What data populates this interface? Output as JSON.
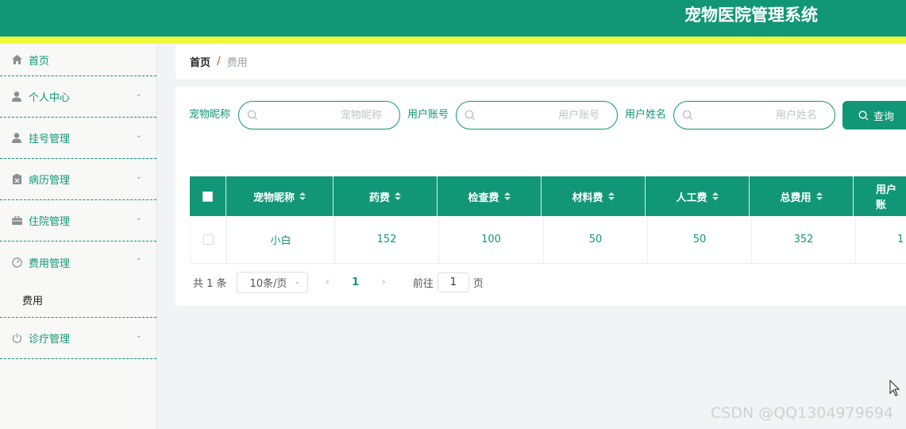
{
  "app": {
    "title": "宠物医院管理系统"
  },
  "colors": {
    "primary": "#119775",
    "accent_bar": "#f0f83c"
  },
  "sidebar": {
    "items": [
      {
        "label": "首页",
        "icon": "home-icon"
      },
      {
        "label": "个人中心",
        "icon": "user-icon"
      },
      {
        "label": "挂号管理",
        "icon": "user-icon"
      },
      {
        "label": "病历管理",
        "icon": "clipboard-icon"
      },
      {
        "label": "住院管理",
        "icon": "briefcase-icon"
      },
      {
        "label": "费用管理",
        "icon": "gauge-icon",
        "sub": [
          {
            "label": "费用"
          }
        ]
      },
      {
        "label": "诊疗管理",
        "icon": "power-icon"
      }
    ]
  },
  "breadcrumb": {
    "home": "首页",
    "separator": "/",
    "current": "费用"
  },
  "search": {
    "fields": [
      {
        "label": "宠物昵称",
        "placeholder": "宠物昵称"
      },
      {
        "label": "用户账号",
        "placeholder": "用户账号"
      },
      {
        "label": "用户姓名",
        "placeholder": "用户姓名"
      }
    ],
    "button_label": "查询"
  },
  "table": {
    "columns": [
      "宠物昵称",
      "药费",
      "检查费",
      "材料费",
      "人工费",
      "总费用",
      "用户账"
    ],
    "rows": [
      [
        "小白",
        "152",
        "100",
        "50",
        "50",
        "352",
        "1"
      ]
    ]
  },
  "pagination": {
    "total_text": "共 1 条",
    "page_size": "10条/页",
    "current_page": "1",
    "goto_label": "前往",
    "goto_value": "1",
    "page_suffix": "页"
  },
  "watermark": "CSDN @QQ1304979694"
}
